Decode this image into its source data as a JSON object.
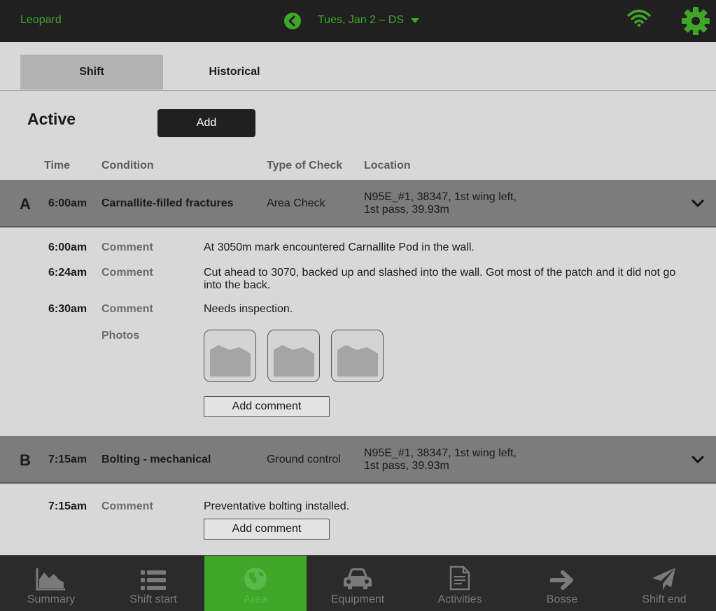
{
  "header": {
    "app_name": "Leopard",
    "shift_selector": "Tues, Jan 2 – DS",
    "accent_color": "#3fa628"
  },
  "tabs": [
    {
      "label": "Shift",
      "active": true
    },
    {
      "label": "Historical",
      "active": false
    }
  ],
  "section": {
    "title": "Active",
    "add_label": "Add"
  },
  "columns": [
    "Time",
    "Condition",
    "Type of Check",
    "Location"
  ],
  "rows": [
    {
      "letter": "A",
      "time": "6:00am",
      "condition": "Carnallite-filled fractures",
      "type": "Area Check",
      "location_line1": "N95E_#1, 38347, 1st wing left,",
      "location_line2": "1st pass, 39.93m",
      "entries": [
        {
          "time": "6:00am",
          "label": "Comment",
          "text": "At 3050m mark encountered Carnallite Pod in the wall."
        },
        {
          "time": "6:24am",
          "label": "Comment",
          "text": "Cut ahead to 3070, backed up and slashed into the wall. Got most of the patch and it did not go into the back."
        },
        {
          "time": "6:30am",
          "label": "Comment",
          "text": "Needs inspection."
        }
      ],
      "photos_label": "Photos",
      "add_comment": "Add comment"
    },
    {
      "letter": "B",
      "time": "7:15am",
      "condition": "Bolting - mechanical",
      "type": "Ground control",
      "location_line1": "N95E_#1, 38347, 1st wing left,",
      "location_line2": "1st pass, 39.93m",
      "entries": [
        {
          "time": "7:15am",
          "label": "Comment",
          "text": "Preventative bolting installed."
        }
      ],
      "add_comment": "Add comment"
    }
  ],
  "nav": [
    {
      "label": "Summary",
      "icon": "chart-icon"
    },
    {
      "label": "Shift start",
      "icon": "list-icon"
    },
    {
      "label": "Area",
      "icon": "globe-icon",
      "active": true
    },
    {
      "label": "Equipment",
      "icon": "car-icon"
    },
    {
      "label": "Activities",
      "icon": "document-icon"
    },
    {
      "label": "Bosse",
      "icon": "arrow-right-icon"
    },
    {
      "label": "Shift end",
      "icon": "send-icon"
    }
  ]
}
